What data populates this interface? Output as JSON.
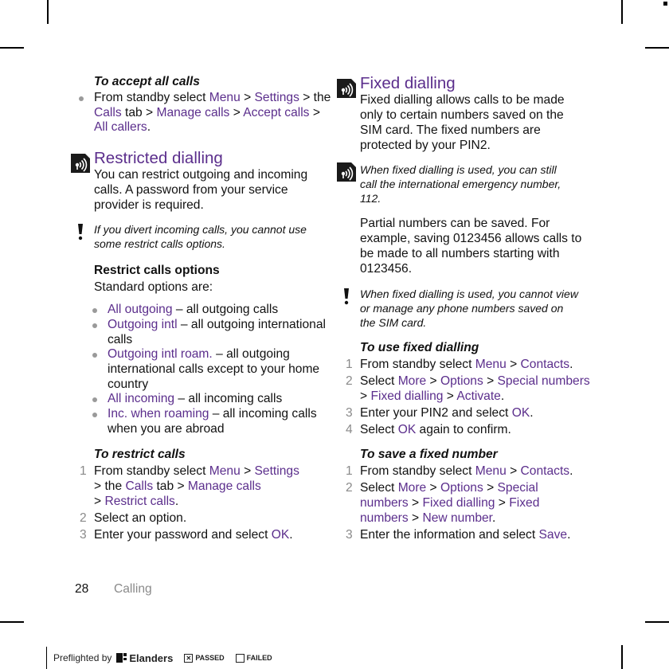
{
  "left": {
    "accept": {
      "heading": "To accept all calls",
      "bullet": {
        "t1": "From standby select ",
        "l1": "Menu",
        "t2": " > ",
        "l2": "Settings",
        "t3": " > the ",
        "l3": "Calls",
        "t4": " tab > ",
        "l4": "Manage calls",
        "t5": " > ",
        "l5": "Accept calls",
        "t6": " > ",
        "l6": "All callers",
        "t7": "."
      }
    },
    "restricted": {
      "title": "Restricted dialling",
      "icon": "network-service-icon",
      "body": "You can restrict outgoing and incoming calls. A password from your service provider is required.",
      "note_icon": "warning-icon",
      "note": "If you divert incoming calls, you cannot use some restrict calls options."
    },
    "options": {
      "heading": "Restrict calls options",
      "intro": "Standard options are:",
      "items": [
        {
          "label": "All outgoing",
          "desc": " – all outgoing calls"
        },
        {
          "label": "Outgoing intl",
          "desc": " – all outgoing international calls"
        },
        {
          "label": "Outgoing intl roam.",
          "desc": " – all outgoing international calls except to your home country"
        },
        {
          "label": "All incoming",
          "desc": " – all incoming calls"
        },
        {
          "label": "Inc. when roaming",
          "desc": " – all incoming calls when you are abroad"
        }
      ]
    },
    "restrict_steps": {
      "heading": "To restrict calls",
      "s1": {
        "num": "1",
        "t1": "From standby select ",
        "l1": "Menu",
        "t2": " > ",
        "l2": "Settings",
        "t3": " > the ",
        "l3": "Calls",
        "t4": " tab > ",
        "l4": "Manage calls",
        "t5": " > ",
        "l5": "Restrict calls",
        "t6": "."
      },
      "s2": {
        "num": "2",
        "text": "Select an option."
      },
      "s3": {
        "num": "3",
        "t1": "Enter your password and select ",
        "l1": "OK",
        "t2": "."
      }
    }
  },
  "right": {
    "fixed": {
      "title": "Fixed dialling",
      "icon": "network-service-icon",
      "body": "Fixed dialling allows calls to be made only to certain numbers saved on the SIM card. The fixed numbers are protected by your PIN2.",
      "note1_icon": "network-service-icon",
      "note1": "When fixed dialling is used, you can still call the international emergency number, 112.",
      "partial": "Partial numbers can be saved. For example, saving 0123456 allows calls to be made to all numbers starting with 0123456.",
      "note2_icon": "warning-icon",
      "note2": "When fixed dialling is used, you cannot view or manage any phone numbers saved on the SIM card."
    },
    "use_steps": {
      "heading": "To use fixed dialling",
      "s1": {
        "num": "1",
        "t1": "From standby select ",
        "l1": "Menu",
        "t2": " > ",
        "l2": "Contacts",
        "t3": "."
      },
      "s2": {
        "num": "2",
        "t1": "Select ",
        "l1": "More",
        "t2": " > ",
        "l2": "Options",
        "t3": " > ",
        "l3": "Special numbers",
        "t4": " > ",
        "l4": "Fixed dialling",
        "t5": " > ",
        "l5": "Activate",
        "t6": "."
      },
      "s3": {
        "num": "3",
        "t1": "Enter your PIN2 and select ",
        "l1": "OK",
        "t2": "."
      },
      "s4": {
        "num": "4",
        "t1": "Select ",
        "l1": "OK",
        "t2": " again to confirm."
      }
    },
    "save_steps": {
      "heading": "To save a fixed number",
      "s1": {
        "num": "1",
        "t1": "From standby select ",
        "l1": "Menu",
        "t2": " > ",
        "l2": "Contacts",
        "t3": "."
      },
      "s2": {
        "num": "2",
        "t1": "Select ",
        "l1": "More",
        "t2": " > ",
        "l2": "Options",
        "t3": " > ",
        "l3": "Special numbers",
        "t4": " > ",
        "l4": "Fixed dialling",
        "t5": " > ",
        "l5": "Fixed numbers",
        "t6": " > ",
        "l6": "New number",
        "t7": "."
      },
      "s3": {
        "num": "3",
        "t1": "Enter the information and select ",
        "l1": "Save",
        "t2": "."
      }
    }
  },
  "footer": {
    "page_number": "28",
    "section": "Calling"
  },
  "preflight": {
    "label": "Preflighted by",
    "brand": "Elanders",
    "passed_mark": "✕",
    "passed": "PASSED",
    "failed": "FAILED"
  },
  "colors": {
    "accent": "#5b2e8c",
    "step_number": "#8a8a8a",
    "bullet": "#9a9a9a"
  }
}
